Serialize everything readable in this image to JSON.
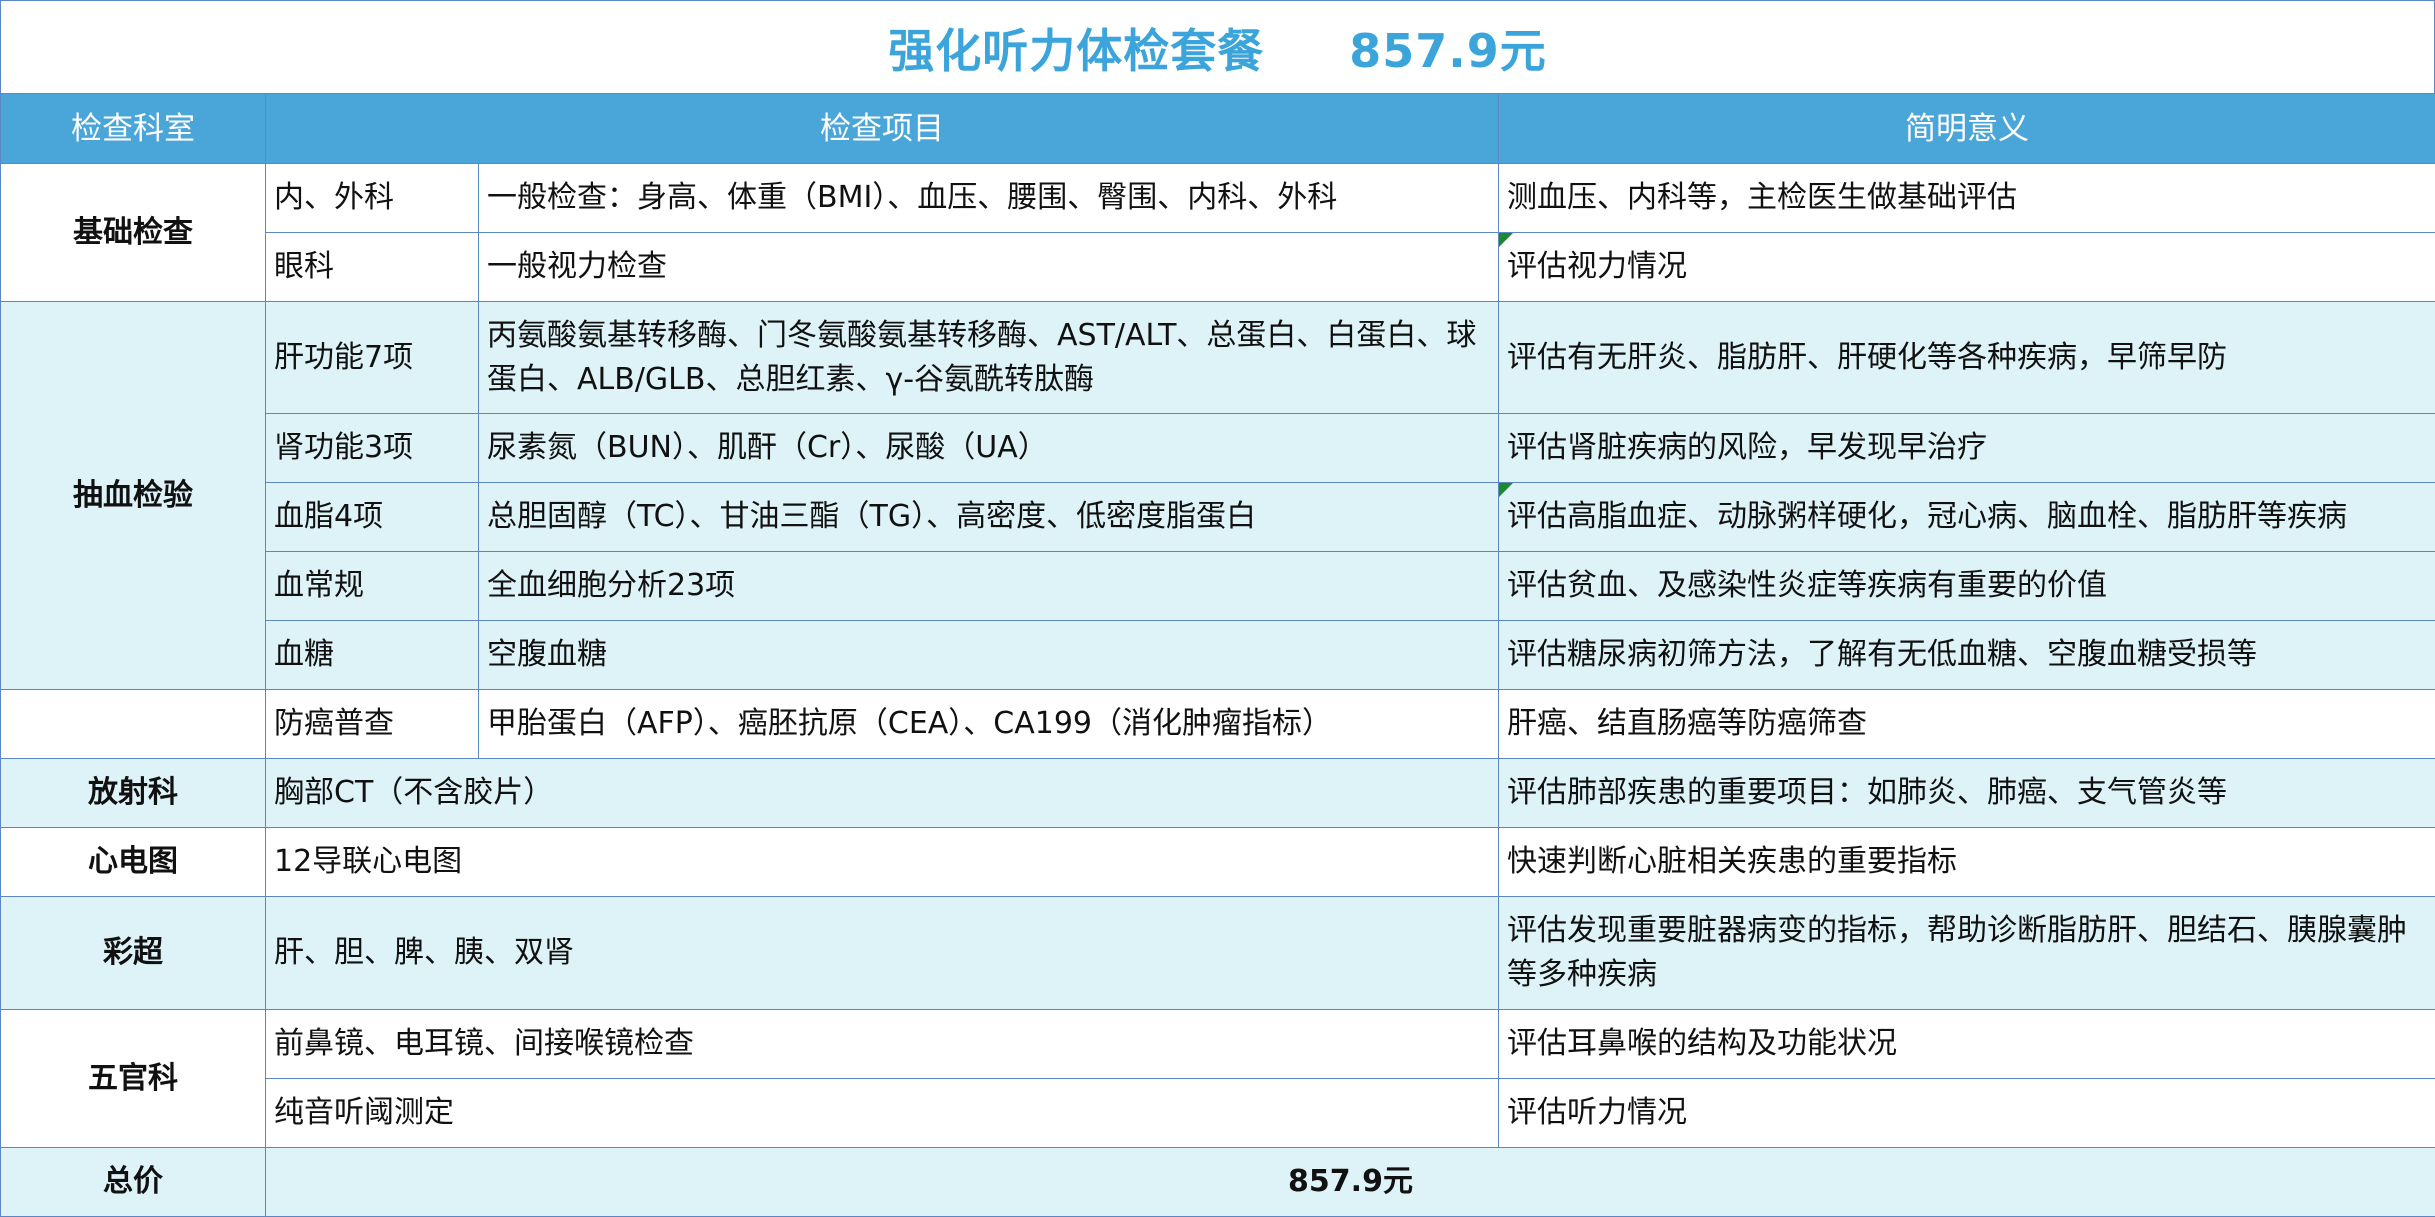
{
  "title": "强化听力体检套餐     857.9元",
  "headers": {
    "dept": "检查科室",
    "item": "检查项目",
    "meaning": "简明意义"
  },
  "rows": [
    {
      "dept": "基础检查",
      "sub": "内、外科",
      "item": "一般检查：身高、体重（BMI）、血压、腰围、臀围、内科、外科",
      "meaning": "测血压、内科等，主检医生做基础评估"
    },
    {
      "sub": "眼科",
      "item": "一般视力检查",
      "meaning": "评估视力情况"
    },
    {
      "dept": "抽血检验",
      "sub": "肝功能7项",
      "item": "丙氨酸氨基转移酶、门冬氨酸氨基转移酶、AST/ALT、总蛋白、白蛋白、球蛋白、ALB/GLB、总胆红素、γ-谷氨酰转肽酶",
      "meaning": "评估有无肝炎、脂肪肝、肝硬化等各种疾病，早筛早防"
    },
    {
      "sub": "肾功能3项",
      "item": "尿素氮（BUN）、肌酐（Cr）、尿酸（UA）",
      "meaning": "评估肾脏疾病的风险，早发现早治疗"
    },
    {
      "sub": "血脂4项",
      "item": "总胆固醇（TC）、甘油三酯（TG）、高密度、低密度脂蛋白",
      "meaning": "评估高脂血症、动脉粥样硬化，冠心病、脑血栓、脂肪肝等疾病"
    },
    {
      "sub": "血常规",
      "item": "全血细胞分析23项",
      "meaning": "评估贫血、及感染性炎症等疾病有重要的价值"
    },
    {
      "sub": "血糖",
      "item": "空腹血糖",
      "meaning": "评估糖尿病初筛方法，了解有无低血糖、空腹血糖受损等"
    },
    {
      "dept": "",
      "sub": "防癌普查",
      "item": "甲胎蛋白（AFP）、癌胚抗原（CEA）、CA199（消化肿瘤指标）",
      "meaning": "肝癌、结直肠癌等防癌筛查"
    },
    {
      "dept": "放射科",
      "item": "胸部CT（不含胶片）",
      "meaning": "评估肺部疾患的重要项目：如肺炎、肺癌、支气管炎等"
    },
    {
      "dept": "心电图",
      "item": "12导联心电图",
      "meaning": "快速判断心脏相关疾患的重要指标"
    },
    {
      "dept": "彩超",
      "item": "肝、胆、脾、胰、双肾",
      "meaning": "评估发现重要脏器病变的指标，帮助诊断脂肪肝、胆结石、胰腺囊肿等多种疾病"
    },
    {
      "dept": "五官科",
      "item": "前鼻镜、电耳镜、间接喉镜检查",
      "meaning": "评估耳鼻喉的结构及功能状况"
    },
    {
      "item": "纯音听阈测定",
      "meaning": "评估听力情况"
    }
  ],
  "total": {
    "label": "总价",
    "value": "857.9元"
  },
  "colors": {
    "title": "#3aa4db",
    "header_bg": "#4aa6d9",
    "alt_row_bg": "#def3f8",
    "border": "#5b87c4"
  }
}
